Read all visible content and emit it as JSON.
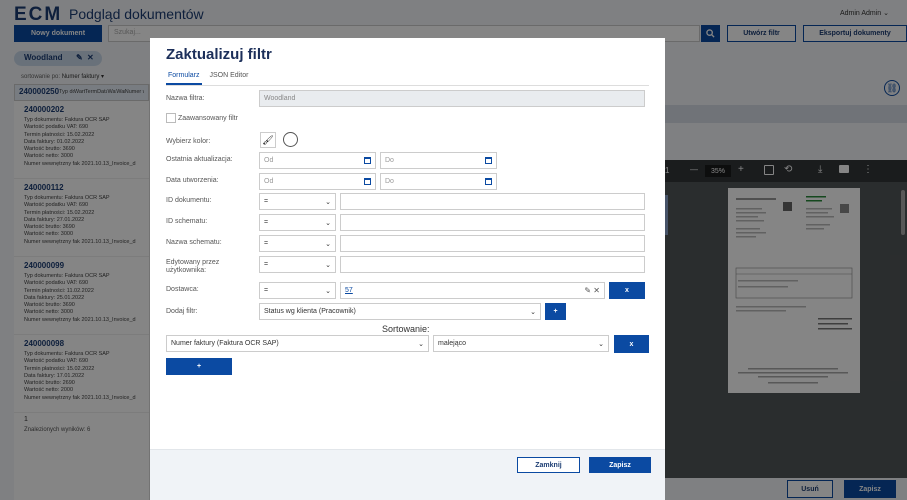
{
  "app": {
    "logo": "ECM",
    "title": "Podgląd dokumentów",
    "user": "Admin Admin ⌄"
  },
  "toolbar": {
    "new_doc": "Nowy dokument",
    "search_placeholder": "Szukaj...",
    "create_filter": "Utwórz filtr",
    "export": "Eksportuj dokumenty"
  },
  "filter_chip": {
    "label": "Woodland"
  },
  "sorting": {
    "prefix": "sortowanie po:",
    "value": "Numer faktury ▾"
  },
  "documents": [
    {
      "id": "240000250",
      "type": "Typ dokumentu: Faktura OCR SAP",
      "vat": "Wartość podatku VAT: 690",
      "term": "Termin płatności: 15.02.2022",
      "date": "Data faktury: 01.02.2022",
      "gross": "Wartość brutto: 3690",
      "net": "Wartość netto: 3000",
      "internal": "Numer wewnętrzny fak 2021.10.13_Invoice_d"
    },
    {
      "id": "240000202",
      "type": "Typ dokumentu: Faktura OCR SAP",
      "vat": "Wartość podatku VAT: 690",
      "term": "Termin płatności: 15.02.2022",
      "date": "Data faktury: 01.02.2022",
      "gross": "Wartość brutto: 3690",
      "net": "Wartość netto: 3000",
      "internal": "Numer wewnętrzny fak 2021.10.13_Invoice_d"
    },
    {
      "id": "240000112",
      "type": "Typ dokumentu: Faktura OCR SAP",
      "vat": "Wartość podatku VAT: 690",
      "term": "Termin płatności: 15.02.2022",
      "date": "Data faktury: 27.01.2022",
      "gross": "Wartość brutto: 3690",
      "net": "Wartość netto: 3000",
      "internal": "Numer wewnętrzny fak 2021.10.13_Invoice_d"
    },
    {
      "id": "240000099",
      "type": "Typ dokumentu: Faktura OCR SAP",
      "vat": "Wartość podatku VAT: 690",
      "term": "Termin płatności: 11.02.2022",
      "date": "Data faktury: 25.01.2022",
      "gross": "Wartość brutto: 3690",
      "net": "Wartość netto: 3000",
      "internal": "Numer wewnętrzny fak 2021.10.13_Invoice_d"
    },
    {
      "id": "240000098",
      "type": "Typ dokumentu: Faktura OCR SAP",
      "vat": "Wartość podatku VAT: 690",
      "term": "Termin płatności: 15.02.2022",
      "date": "Data faktury: 17.01.2022",
      "gross": "Wartość brutto: 2690",
      "net": "Wartość netto: 2000",
      "internal": "Numer wewnętrzny fak 2021.10.13_Invoice_d"
    }
  ],
  "pagination": {
    "page": "1",
    "results": "Znalezionych wyników: 6"
  },
  "pdf": {
    "page": "1",
    "zoom": "35%",
    "minus": "—",
    "plus": "+"
  },
  "bottom": {
    "delete": "Usuń",
    "save": "Zapisz"
  },
  "modal": {
    "title": "Zaktualizuj filtr",
    "tabs": [
      {
        "label": "Formularz"
      },
      {
        "label": "JSON Editor"
      }
    ],
    "filter_name": {
      "label": "Nazwa filtra:",
      "value": "Woodland"
    },
    "advanced": {
      "label": "Zaawansowany filtr"
    },
    "color": {
      "label": "Wybierz kolor:"
    },
    "last_update": {
      "label": "Ostatnia aktualizacja:",
      "from": "Od",
      "to": "Do"
    },
    "created": {
      "label": "Data utworzenia:",
      "from": "Od",
      "to": "Do"
    },
    "doc_id": {
      "label": "ID dokumentu:",
      "op": "="
    },
    "schema_id": {
      "label": "ID schematu:",
      "op": "="
    },
    "schema_name": {
      "label": "Nazwa schematu:",
      "op": "="
    },
    "edited_by": {
      "label": "Edytowany przez użytkownika:",
      "op": "="
    },
    "supplier": {
      "label": "Dostawca:",
      "op": "=",
      "value": "57",
      "remove": "x"
    },
    "add_filter": {
      "label": "Dodaj filtr:",
      "value": "Status wg klienta (Pracownik)",
      "add": "+"
    },
    "sorting": {
      "label": "Sortowanie:",
      "field": "Numer faktury (Faktura OCR SAP)",
      "order": "malejąco",
      "remove": "x",
      "add": "+"
    },
    "footer": {
      "close": "Zamknij",
      "save": "Zapisz"
    }
  },
  "colors": {
    "primary": "#0b4aa2",
    "title": "#1c2f5a"
  }
}
